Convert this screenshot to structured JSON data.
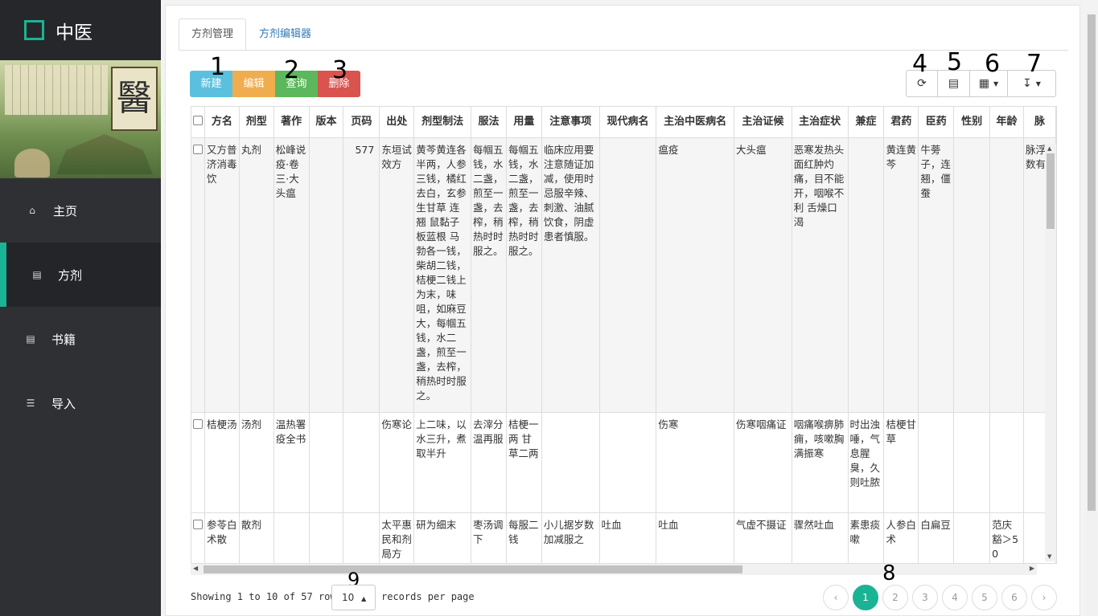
{
  "app": {
    "brand": "中医",
    "accent": "#1ab394",
    "banner_seal": "醫"
  },
  "sidebar": {
    "items": [
      {
        "label": "主页",
        "icon": "home-icon"
      },
      {
        "label": "方剂",
        "icon": "bar-chart-icon"
      },
      {
        "label": "书籍",
        "icon": "bar-chart-icon"
      },
      {
        "label": "导入",
        "icon": "database-icon"
      }
    ],
    "active_index": 1
  },
  "tabs": [
    {
      "label": "方剂管理"
    },
    {
      "label": "方剂编辑器"
    }
  ],
  "toolbar": {
    "new": "新建",
    "edit": "编辑",
    "query": "查询",
    "delete": "删除"
  },
  "tools": {
    "refresh": "refresh-icon",
    "toggle": "list-icon",
    "columns": "grid-icon",
    "export": "export-icon"
  },
  "annotations": [
    "1",
    "2",
    "3",
    "4",
    "5",
    "6",
    "7",
    "8",
    "9"
  ],
  "table": {
    "headers": [
      "方名",
      "剂型",
      "著作",
      "版本",
      "页码",
      "出处",
      "剂型制法",
      "服法",
      "用量",
      "注意事项",
      "现代病名",
      "主治中医病名",
      "主治证候",
      "主治症状",
      "兼症",
      "君药",
      "臣药",
      "性别",
      "年龄",
      "脉"
    ],
    "rows": [
      [
        "又方普济消毒饮",
        "丸剂",
        "松峰说疫·卷三·大头瘟",
        "",
        "577",
        "东垣试效方",
        "黄芩黄连各半两，人参三钱，橘红去白，玄参生甘草 连翘 鼠黏子板蓝根 马勃各一钱，柴胡二钱，桔梗二钱上为末，味咀，如麻豆大，每帼五钱，水二盏，煎至一盏，去榨，稍热时时服之。",
        "每帼五钱，水二盏，煎至一盏，去榨，稍热时时服之。",
        "每帼五钱，水二盏，煎至一盏，去榨，稍热时时服之。",
        "临床应用要注意随证加减，使用时忌服辛辣、刺激、油腻饮食，阴虚患者慎服。",
        "",
        "瘟疫",
        "大头瘟",
        "恶寒发热头面红肿灼痛，目不能开，咽喉不利 舌燥口渴",
        "",
        "黄连黄芩",
        "牛蒡子，连翘，僵蚕",
        "",
        "",
        "脉浮数有"
      ],
      [
        "桔梗汤",
        "汤剂",
        "温热署疫全书",
        "",
        "",
        "伤寒论",
        "上二味，以水三升，煮取半升",
        "去滓分温再服",
        "桔梗一两 甘草二两",
        "",
        "",
        "伤寒",
        "伤寒咽痛证",
        "咽痛喉痹肺痈，咳嗽胸满振寒",
        "时出浊唾，气息腥臭，久则吐脓",
        "桔梗甘草",
        "",
        "",
        "",
        ""
      ],
      [
        "参苓白术散",
        "散剂",
        "",
        "",
        "",
        "太平惠民和剂局方",
        "研为细末",
        "枣汤调下",
        "每服二钱",
        "小儿据岁数加减服之",
        "吐血",
        "吐血",
        "气虚不摄证",
        "骤然吐血",
        "素患痰嗽",
        "人参白术",
        "白扁豆",
        "",
        "范庆豁＞50",
        ""
      ]
    ]
  },
  "footer": {
    "showing": "Showing 1 to 10 of 57 rows",
    "page_size": "10",
    "per_page": "records per page"
  },
  "pagination": {
    "prev": "‹",
    "pages": [
      "1",
      "2",
      "3",
      "4",
      "5",
      "6"
    ],
    "next": "›",
    "active": "1"
  }
}
